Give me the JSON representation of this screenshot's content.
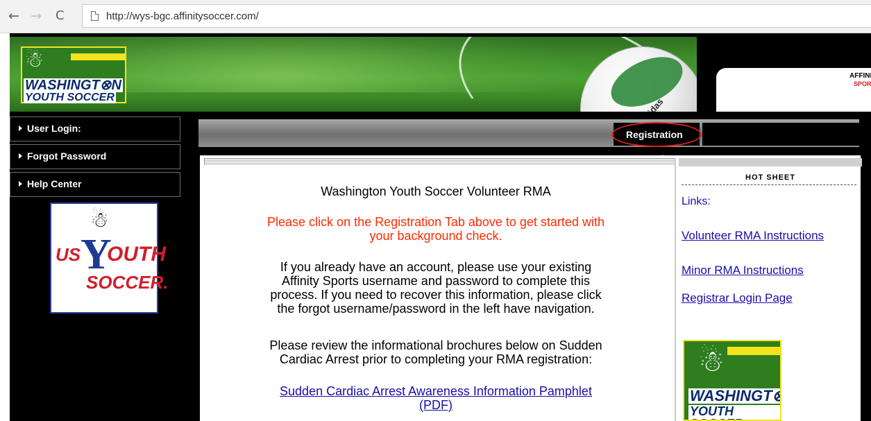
{
  "browser": {
    "url": "http://wys-bgc.affinitysoccer.com/",
    "back_glyph": "←",
    "forward_glyph": "→",
    "reload_glyph": "C"
  },
  "header": {
    "logo_line1": "WASHINGT⊗N",
    "logo_line2": "YOUTH SOCCER",
    "ball_brand": "adidas",
    "affinity_line1": "AFFINITY",
    "affinity_line2": "SPORTS"
  },
  "sidebar": {
    "items": [
      {
        "label": "User Login:"
      },
      {
        "label": "Forgot Password"
      },
      {
        "label": "Help Center"
      }
    ],
    "usys": {
      "us": "US",
      "y": "Y",
      "outh": "OUTH",
      "soccer": "SOCCER."
    }
  },
  "nav": {
    "registration_label": "Registration"
  },
  "main": {
    "title": "Washington Youth Soccer Volunteer RMA",
    "notice_line1": "Please click on the Registration Tab above to get started with",
    "notice_line2": "your background check.",
    "para1_line1": "If you already have an account, please use your existing",
    "para1_line2": "Affinity Sports username and password to complete this",
    "para1_line3": "process.  If you need to recover this information, please click",
    "para1_line4": "the forgot username/password in the left have navigation.",
    "para2_line1": "Please review the informational brochures below on Sudden",
    "para2_line2": "Cardiac Arrest prior to completing your RMA registration:",
    "link_line1": "Sudden Cardiac Arrest Awareness Information Pamphlet",
    "link_line2": "(PDF)"
  },
  "hot_sheet": {
    "title": "Hot Sheet",
    "links_heading": "Links:",
    "links": [
      "Volunteer RMA Instructions",
      "Minor RMA Instructions",
      "Registrar Login Page"
    ],
    "logo_line1": "WASHINGT⊗N",
    "logo_line2": "YOUTH SOCCER"
  },
  "colors": {
    "notice_red": "#ff2a00",
    "link_blue": "#1a0dab",
    "annotation_red": "#e11f1f",
    "grass_green": "#3d8a2a"
  },
  "icons": [
    "back-arrow-icon",
    "forward-arrow-icon",
    "reload-icon",
    "page-icon",
    "sidebar-arrow-icon",
    "annotation-arrow-icon"
  ]
}
